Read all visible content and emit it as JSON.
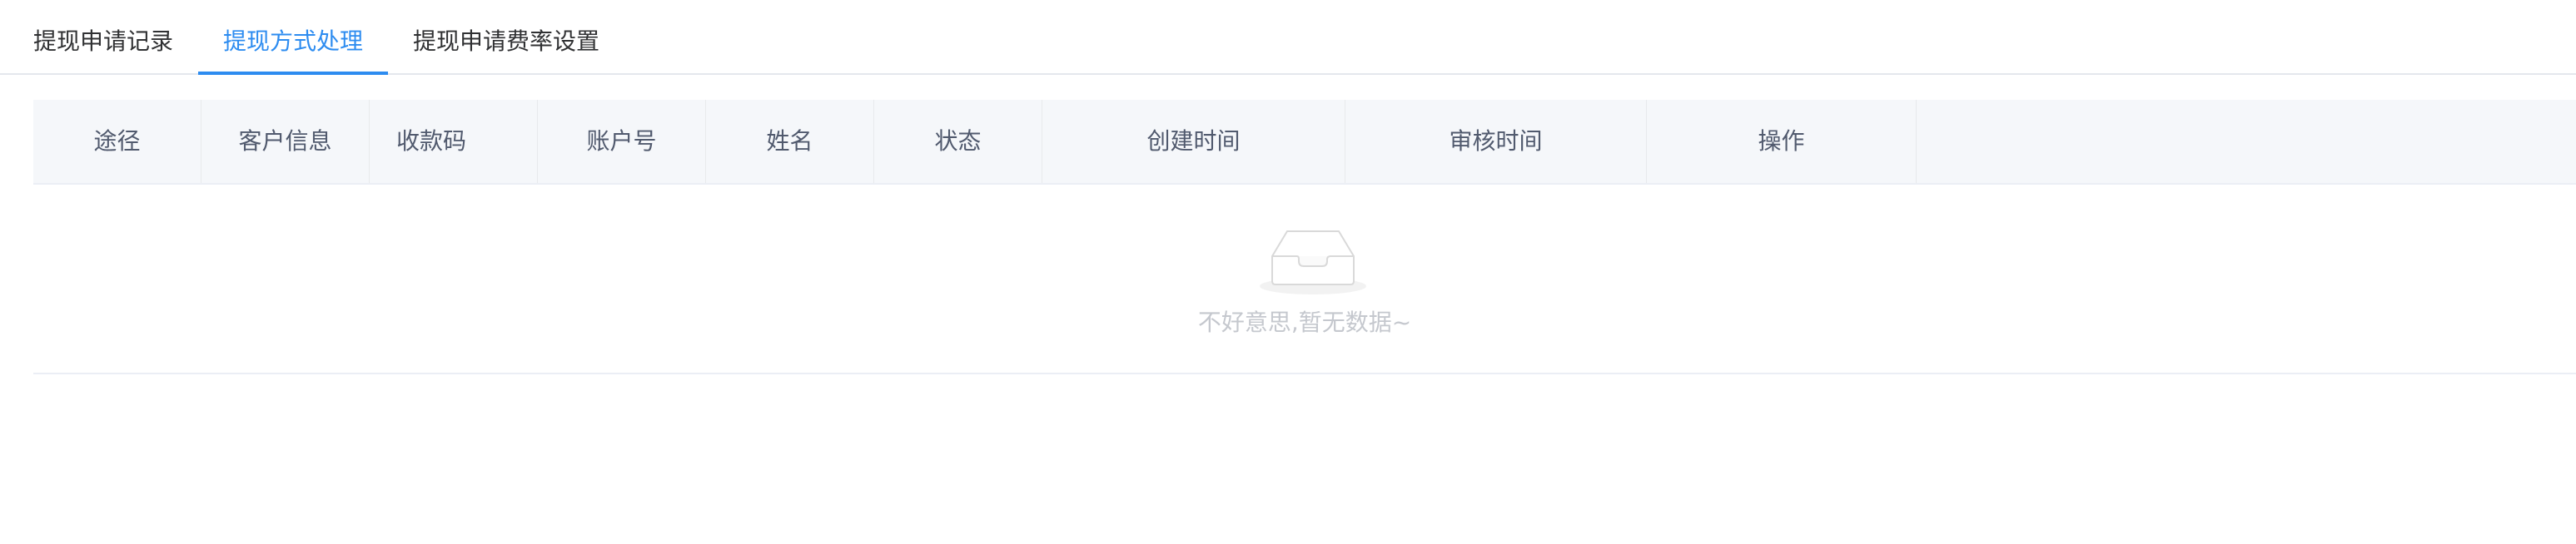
{
  "tabs": [
    {
      "label": "提现申请记录",
      "active": false
    },
    {
      "label": "提现方式处理",
      "active": true
    },
    {
      "label": "提现申请费率设置",
      "active": false
    }
  ],
  "table": {
    "columns": [
      "途径",
      "客户信息",
      "收款码",
      "账户号",
      "姓名",
      "状态",
      "创建时间",
      "审核时间",
      "操作"
    ],
    "rows": []
  },
  "empty": {
    "icon": "empty-inbox-icon",
    "text": "不好意思,暂无数据~"
  },
  "colors": {
    "accent": "#2d8cf0",
    "header_bg": "#f5f7fa",
    "empty_text": "#c5c8ce"
  }
}
